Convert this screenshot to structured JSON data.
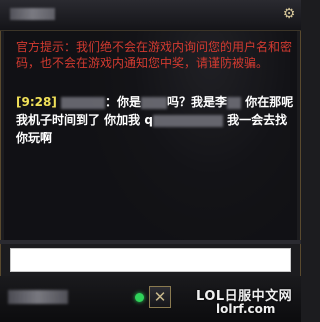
{
  "window": {
    "gear_icon": "gear-icon"
  },
  "system_message": {
    "text": "官方提示：我们绝不会在游戏内询问您的用户名和密码，也不会在游戏内通知您中奖，请谨防被骗。",
    "color": "#d23a30"
  },
  "chat": {
    "timestamp": "[9:28]",
    "timestamp_color": "#f0e058",
    "segments": [
      "：你是",
      "吗？我是李",
      "你在那呢 我机子时间到了 你加我 q",
      "我一会去找你玩啊"
    ]
  },
  "input": {
    "value": "",
    "placeholder": ""
  },
  "footer": {
    "status_color": "#2fd35a",
    "close_label": "✕"
  },
  "watermark": {
    "title": "LOL日服中文网",
    "url": "lolrf.com"
  }
}
